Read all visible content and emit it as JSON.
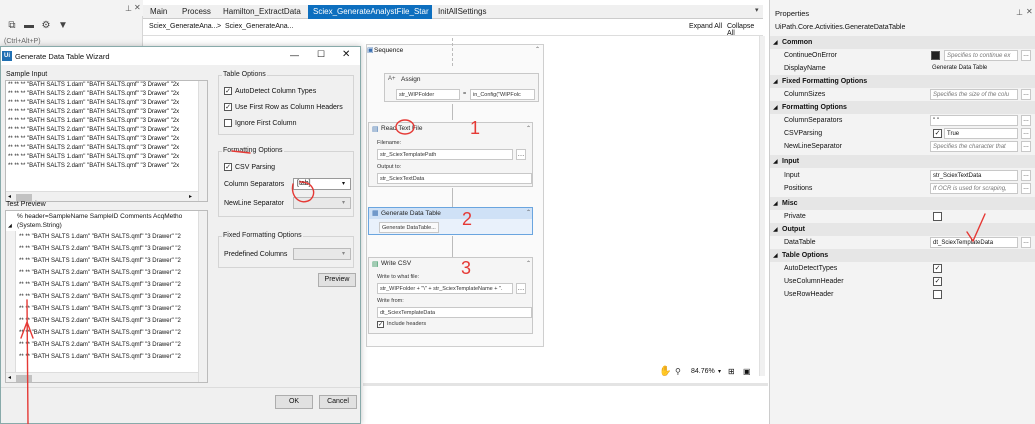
{
  "left_panel": {
    "search_hint": "(Ctrl+Alt+P)"
  },
  "tabs": [
    {
      "label": "Main"
    },
    {
      "label": "Process"
    },
    {
      "label": "Hamilton_ExtractData"
    },
    {
      "label": "Sciex_GenerateAnalystFile_Star"
    },
    {
      "label": "InitAllSettings"
    }
  ],
  "breadcrumb": {
    "item1": "Sciex_GenerateAna...",
    "sep": ">",
    "item2": "Sciex_GenerateAna...",
    "expand_all": "Expand All",
    "collapse_all": "Collapse All"
  },
  "canvas": {
    "sequence_label": "Sequence",
    "assign": {
      "title": "Assign",
      "to": "str_WIPFolder",
      "eq": "=",
      "value": "in_Config(\"WIPFolc"
    },
    "read_text_file": {
      "title": "Read Text File",
      "filename_label": "Filename:",
      "filename": "str_SciexTemplatePath",
      "output_label": "Output to:",
      "output": "str_SciexTextData"
    },
    "generate_data_table": {
      "title": "Generate Data Table",
      "button": "Generate DataTable..."
    },
    "write_csv": {
      "title": "Write CSV",
      "write_to_label": "Write to what file:",
      "write_to": "str_WIPFolder + \"\\\" + str_SciexTemplateName + \".",
      "write_from_label": "Write from:",
      "write_from": "dt_SciexTemplateData",
      "include_headers": "Include headers"
    },
    "zoom": "84.76%"
  },
  "dialog": {
    "title": "Generate Data Table Wizard",
    "icon_text": "Ui",
    "sample_input_label": "Sample Input",
    "sample_rows": [
      "** ** ** \"BATH SALTS 1.dam\" \"BATH SALTS.qmf\" \"3 Drawer\" \"2x",
      "** ** ** \"BATH SALTS 2.dam\" \"BATH SALTS.qmf\" \"3 Drawer\" \"2x",
      "** ** ** \"BATH SALTS 1.dam\" \"BATH SALTS.qmf\" \"3 Drawer\" \"2x",
      "** ** ** \"BATH SALTS 2.dam\" \"BATH SALTS.qmf\" \"3 Drawer\" \"2x",
      "** ** ** \"BATH SALTS 1.dam\" \"BATH SALTS.qmf\" \"3 Drawer\" \"2x",
      "** ** ** \"BATH SALTS 2.dam\" \"BATH SALTS.qmf\" \"3 Drawer\" \"2x",
      "** ** ** \"BATH SALTS 1.dam\" \"BATH SALTS.qmf\" \"3 Drawer\" \"2x",
      "** ** ** \"BATH SALTS 2.dam\" \"BATH SALTS.qmf\" \"3 Drawer\" \"2x",
      "** ** ** \"BATH SALTS 1.dam\" \"BATH SALTS.qmf\" \"3 Drawer\" \"2x",
      "** ** ** \"BATH SALTS 2.dam\" \"BATH SALTS.qmf\" \"3 Drawer\" \"2x"
    ],
    "table_options_label": "Table Options",
    "auto_detect": "AutoDetect Column Types",
    "first_row_headers": "Use First Row as Column Headers",
    "ignore_first": "Ignore First Column",
    "formatting_label": "Formatting Options",
    "csv_parsing": "CSV Parsing",
    "column_sep_label": "Column Separators",
    "column_sep_value": "[tab]",
    "newline_sep_label": "NewLine Separator",
    "fixed_label": "Fixed Formatting Options",
    "predefined_label": "Predefined Columns",
    "preview_button": "Preview",
    "test_preview_label": "Test Preview",
    "preview_header": "% header=SampleName SampleID Comments AcqMetho",
    "preview_header_type": "(System.String)",
    "preview_rows": [
      "** ** \"BATH SALTS 1.dam\" \"BATH SALTS.qmf\" \"3 Drawer\" \"2",
      "** ** \"BATH SALTS 2.dam\" \"BATH SALTS.qmf\" \"3 Drawer\" \"2",
      "** ** \"BATH SALTS 1.dam\" \"BATH SALTS.qmf\" \"3 Drawer\" \"2",
      "** ** \"BATH SALTS 2.dam\" \"BATH SALTS.qmf\" \"3 Drawer\" \"2",
      "** ** \"BATH SALTS 1.dam\" \"BATH SALTS.qmf\" \"3 Drawer\" \"2",
      "** ** \"BATH SALTS 2.dam\" \"BATH SALTS.qmf\" \"3 Drawer\" \"2",
      "** ** \"BATH SALTS 1.dam\" \"BATH SALTS.qmf\" \"3 Drawer\" \"2",
      "** ** \"BATH SALTS 2.dam\" \"BATH SALTS.qmf\" \"3 Drawer\" \"2",
      "** ** \"BATH SALTS 1.dam\" \"BATH SALTS.qmf\" \"3 Drawer\" \"2",
      "** ** \"BATH SALTS 2.dam\" \"BATH SALTS.qmf\" \"3 Drawer\" \"2",
      "** ** \"BATH SALTS 1.dam\" \"BATH SALTS.qmf\" \"3 Drawer\" \"2"
    ],
    "ok_button": "OK",
    "cancel_button": "Cancel"
  },
  "properties": {
    "title": "Properties",
    "subtitle": "UiPath.Core.Activities.GenerateDataTable",
    "common": "Common",
    "continue_on_error": "ContinueOnError",
    "continue_on_error_value": "Specifies to continue ex",
    "display_name": "DisplayName",
    "display_name_value": "Generate Data Table",
    "fixed_formatting": "Fixed Formatting Options",
    "column_sizes": "ColumnSizes",
    "column_sizes_value": "Specifies the size of the colu",
    "formatting": "Formatting Options",
    "column_separators": "ColumnSeparators",
    "column_separators_value": "\"          \"",
    "csv_parsing": "CSVParsing",
    "csv_parsing_value": "True",
    "newline_separator": "NewLineSeparator",
    "newline_separator_value": "Specifies the character that",
    "input": "Input",
    "input_prop": "Input",
    "input_value": "str_SciexTextData",
    "positions": "Positions",
    "positions_value": "If OCR is used for scraping,",
    "misc": "Misc",
    "private": "Private",
    "output": "Output",
    "data_table": "DataTable",
    "data_table_value": "dt_SciexTemplateData",
    "table_options": "Table Options",
    "auto_detect_types": "AutoDetectTypes",
    "use_column_header": "UseColumnHeader",
    "use_row_header": "UseRowHeader"
  },
  "annotations": {
    "n1": "1",
    "n2": "2",
    "n3": "3"
  },
  "colors": {
    "accent": "#0d6fbf",
    "annotation": "#e53935"
  }
}
